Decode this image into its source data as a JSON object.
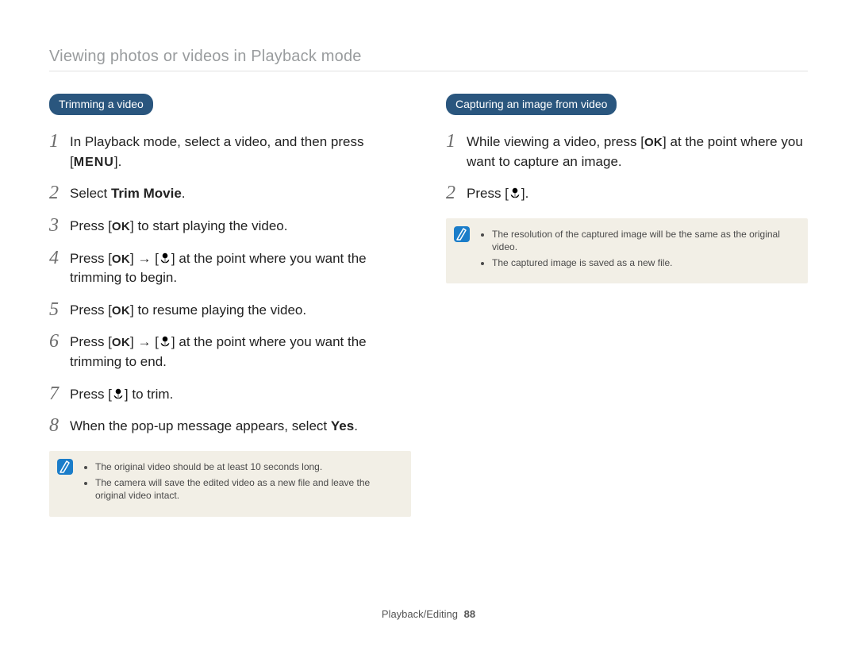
{
  "header": "Viewing photos or videos in Playback mode",
  "left": {
    "pill": "Trimming a video",
    "steps": [
      {
        "num": "1",
        "pre": "In Playback mode, select a video, and then press [",
        "key": "MENU",
        "post": "]."
      },
      {
        "num": "2",
        "pre": "Select ",
        "bold": "Trim Movie",
        "post": "."
      },
      {
        "num": "3",
        "pre": "Press [",
        "key": "OK",
        "post": "] to start playing the video."
      },
      {
        "num": "4",
        "pre": "Press [",
        "key": "OK",
        "mid": "] → [",
        "icon": "macro",
        "post": "] at the point where you want the trimming to begin."
      },
      {
        "num": "5",
        "pre": "Press [",
        "key": "OK",
        "post": "] to resume playing the video."
      },
      {
        "num": "6",
        "pre": "Press [",
        "key": "OK",
        "mid": "] → [",
        "icon": "macro",
        "post": "] at the point where you want the trimming to end."
      },
      {
        "num": "7",
        "pre": "Press [",
        "icon": "macro",
        "post": "] to trim."
      },
      {
        "num": "8",
        "pre": "When the pop-up message appears, select ",
        "bold": "Yes",
        "post": "."
      }
    ],
    "notes": [
      "The original video should be at least 10 seconds long.",
      "The camera will save the edited video as a new file and leave the original video intact."
    ]
  },
  "right": {
    "pill": "Capturing an image from video",
    "steps": [
      {
        "num": "1",
        "pre": "While viewing a video, press [",
        "key": "OK",
        "post": "] at the point where you want to capture an image."
      },
      {
        "num": "2",
        "pre": "Press [",
        "icon": "macro",
        "post": "]."
      }
    ],
    "notes": [
      "The resolution of the captured image will be the same as the original video.",
      "The captured image is saved as a new file."
    ]
  },
  "footer": {
    "section": "Playback/Editing",
    "page": "88"
  }
}
